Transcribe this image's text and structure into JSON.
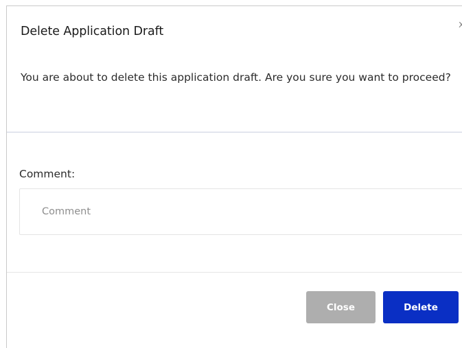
{
  "dialog": {
    "title": "Delete Application Draft",
    "close_glyph": "x",
    "message": "You are about to delete this application draft. Are you sure you want to proceed?",
    "comment": {
      "label": "Comment:",
      "placeholder": "Comment",
      "value": ""
    },
    "buttons": {
      "close_label": "Close",
      "delete_label": "Delete"
    }
  },
  "colors": {
    "primary": "#0a2fc4",
    "disabled": "#aeaeae"
  }
}
